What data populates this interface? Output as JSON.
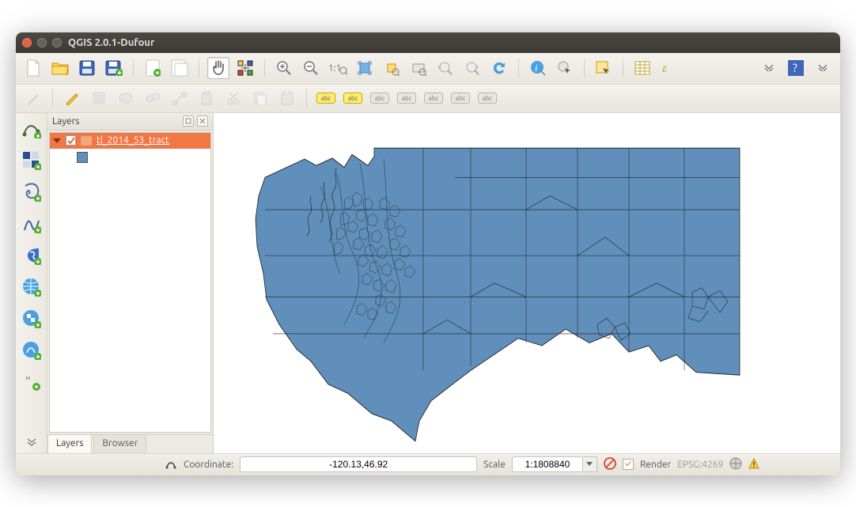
{
  "window": {
    "title": "QGIS 2.0.1-Dufour"
  },
  "layers_panel": {
    "title": "Layers",
    "layer_name": "tl_2014_53_tract",
    "tabs": {
      "layers": "Layers",
      "browser": "Browser"
    }
  },
  "label_text": "abc",
  "status": {
    "coord_label": "Coordinate:",
    "coord_value": "-120.13,46.92",
    "scale_label": "Scale",
    "scale_value": "1:1808840",
    "render_label": "Render",
    "crs": "EPSG:4269"
  }
}
